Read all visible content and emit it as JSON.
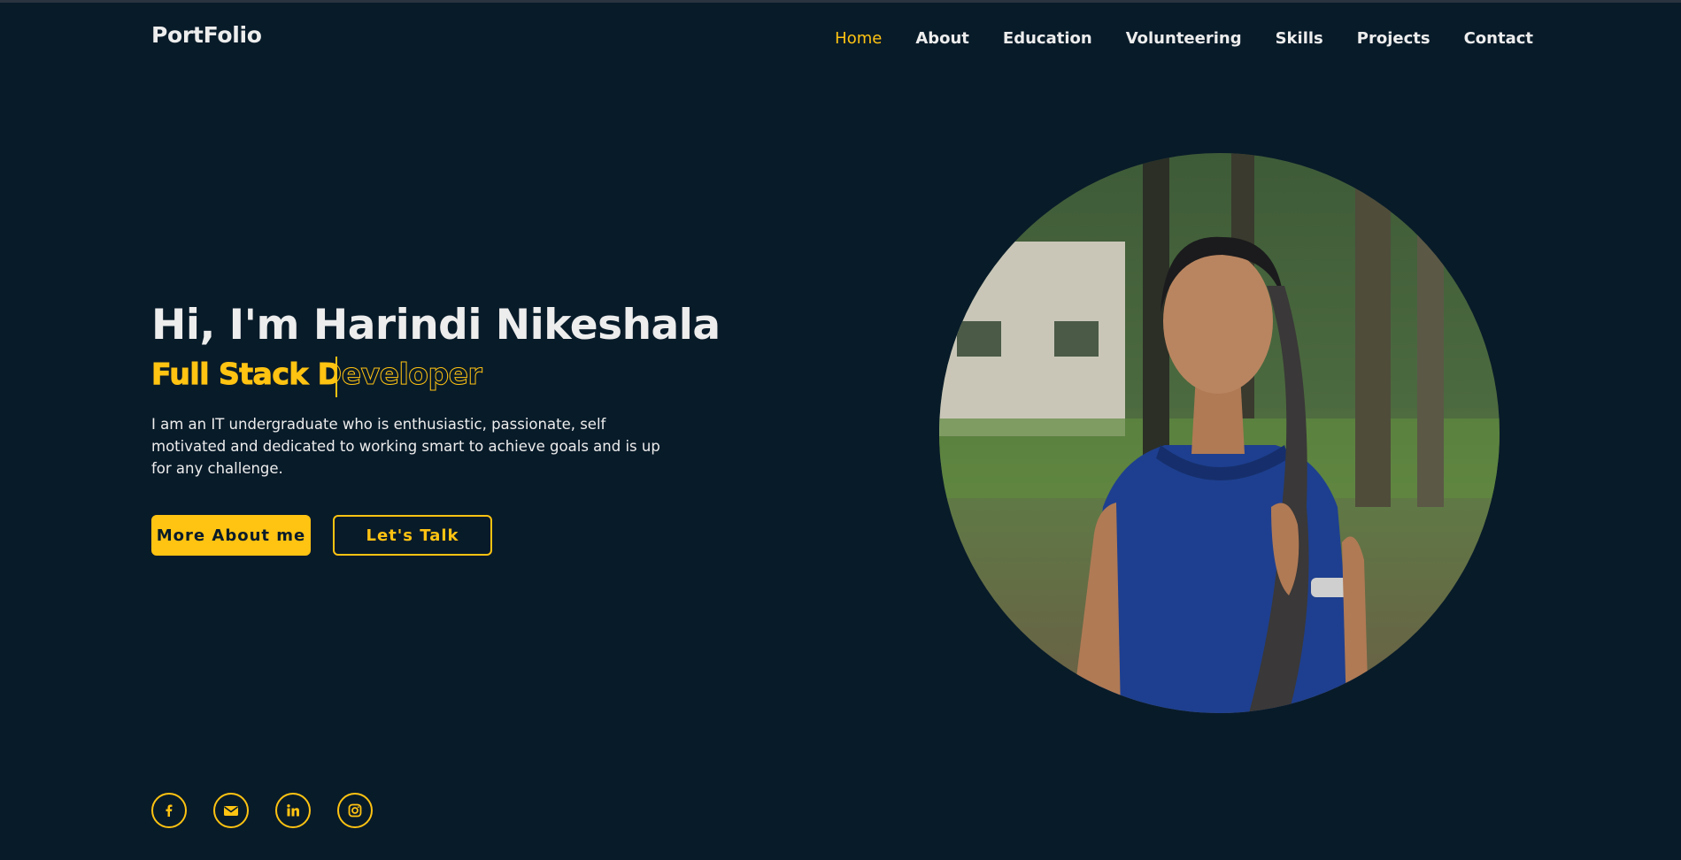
{
  "header": {
    "logo": "PortFolio",
    "nav": [
      "Home",
      "About",
      "Education",
      "Volunteering",
      "Skills",
      "Projects",
      "Contact"
    ]
  },
  "hero": {
    "greeting": "Hi, I'm Harindi Nikeshala",
    "role": "Full Stack Developer",
    "role_typed": "Full Stack De",
    "description": "I am an IT undergraduate who is enthusiastic, passionate, self motivated and dedicated to working smart to achieve goals and is up for any challenge.",
    "buttons": {
      "primary": "More About me",
      "secondary": "Let's Talk"
    }
  },
  "socials": [
    "facebook-icon",
    "email-icon",
    "linkedin-icon",
    "instagram-icon"
  ],
  "colors": {
    "background": "#081b29",
    "accent": "#ffc312",
    "text": "#ededed"
  }
}
